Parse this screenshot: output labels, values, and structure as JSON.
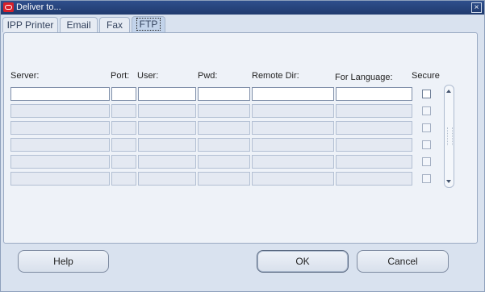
{
  "window": {
    "title": "Deliver to...",
    "close_glyph": "×"
  },
  "tabs": [
    {
      "label": "IPP Printer",
      "active": false
    },
    {
      "label": "Email",
      "active": false
    },
    {
      "label": "Fax",
      "active": false
    },
    {
      "label": "FTP",
      "active": true
    }
  ],
  "columns": {
    "server": "Server:",
    "port": "Port:",
    "user": "User:",
    "pwd": "Pwd:",
    "remote_dir": "Remote Dir:",
    "language": "For Language:",
    "secure": "Secure"
  },
  "rows": [
    {
      "server": "",
      "port": "",
      "user": "",
      "pwd": "",
      "remote_dir": "",
      "language": "",
      "secure": false
    },
    {
      "server": "",
      "port": "",
      "user": "",
      "pwd": "",
      "remote_dir": "",
      "language": "",
      "secure": false
    },
    {
      "server": "",
      "port": "",
      "user": "",
      "pwd": "",
      "remote_dir": "",
      "language": "",
      "secure": false
    },
    {
      "server": "",
      "port": "",
      "user": "",
      "pwd": "",
      "remote_dir": "",
      "language": "",
      "secure": false
    },
    {
      "server": "",
      "port": "",
      "user": "",
      "pwd": "",
      "remote_dir": "",
      "language": "",
      "secure": false
    },
    {
      "server": "",
      "port": "",
      "user": "",
      "pwd": "",
      "remote_dir": "",
      "language": "",
      "secure": false
    }
  ],
  "buttons": {
    "help": "Help",
    "ok": "OK",
    "cancel": "Cancel"
  },
  "icons": {
    "title": "oracle-logo-icon",
    "scroll_up": "chevron-up-icon",
    "scroll_down": "chevron-down-icon"
  }
}
